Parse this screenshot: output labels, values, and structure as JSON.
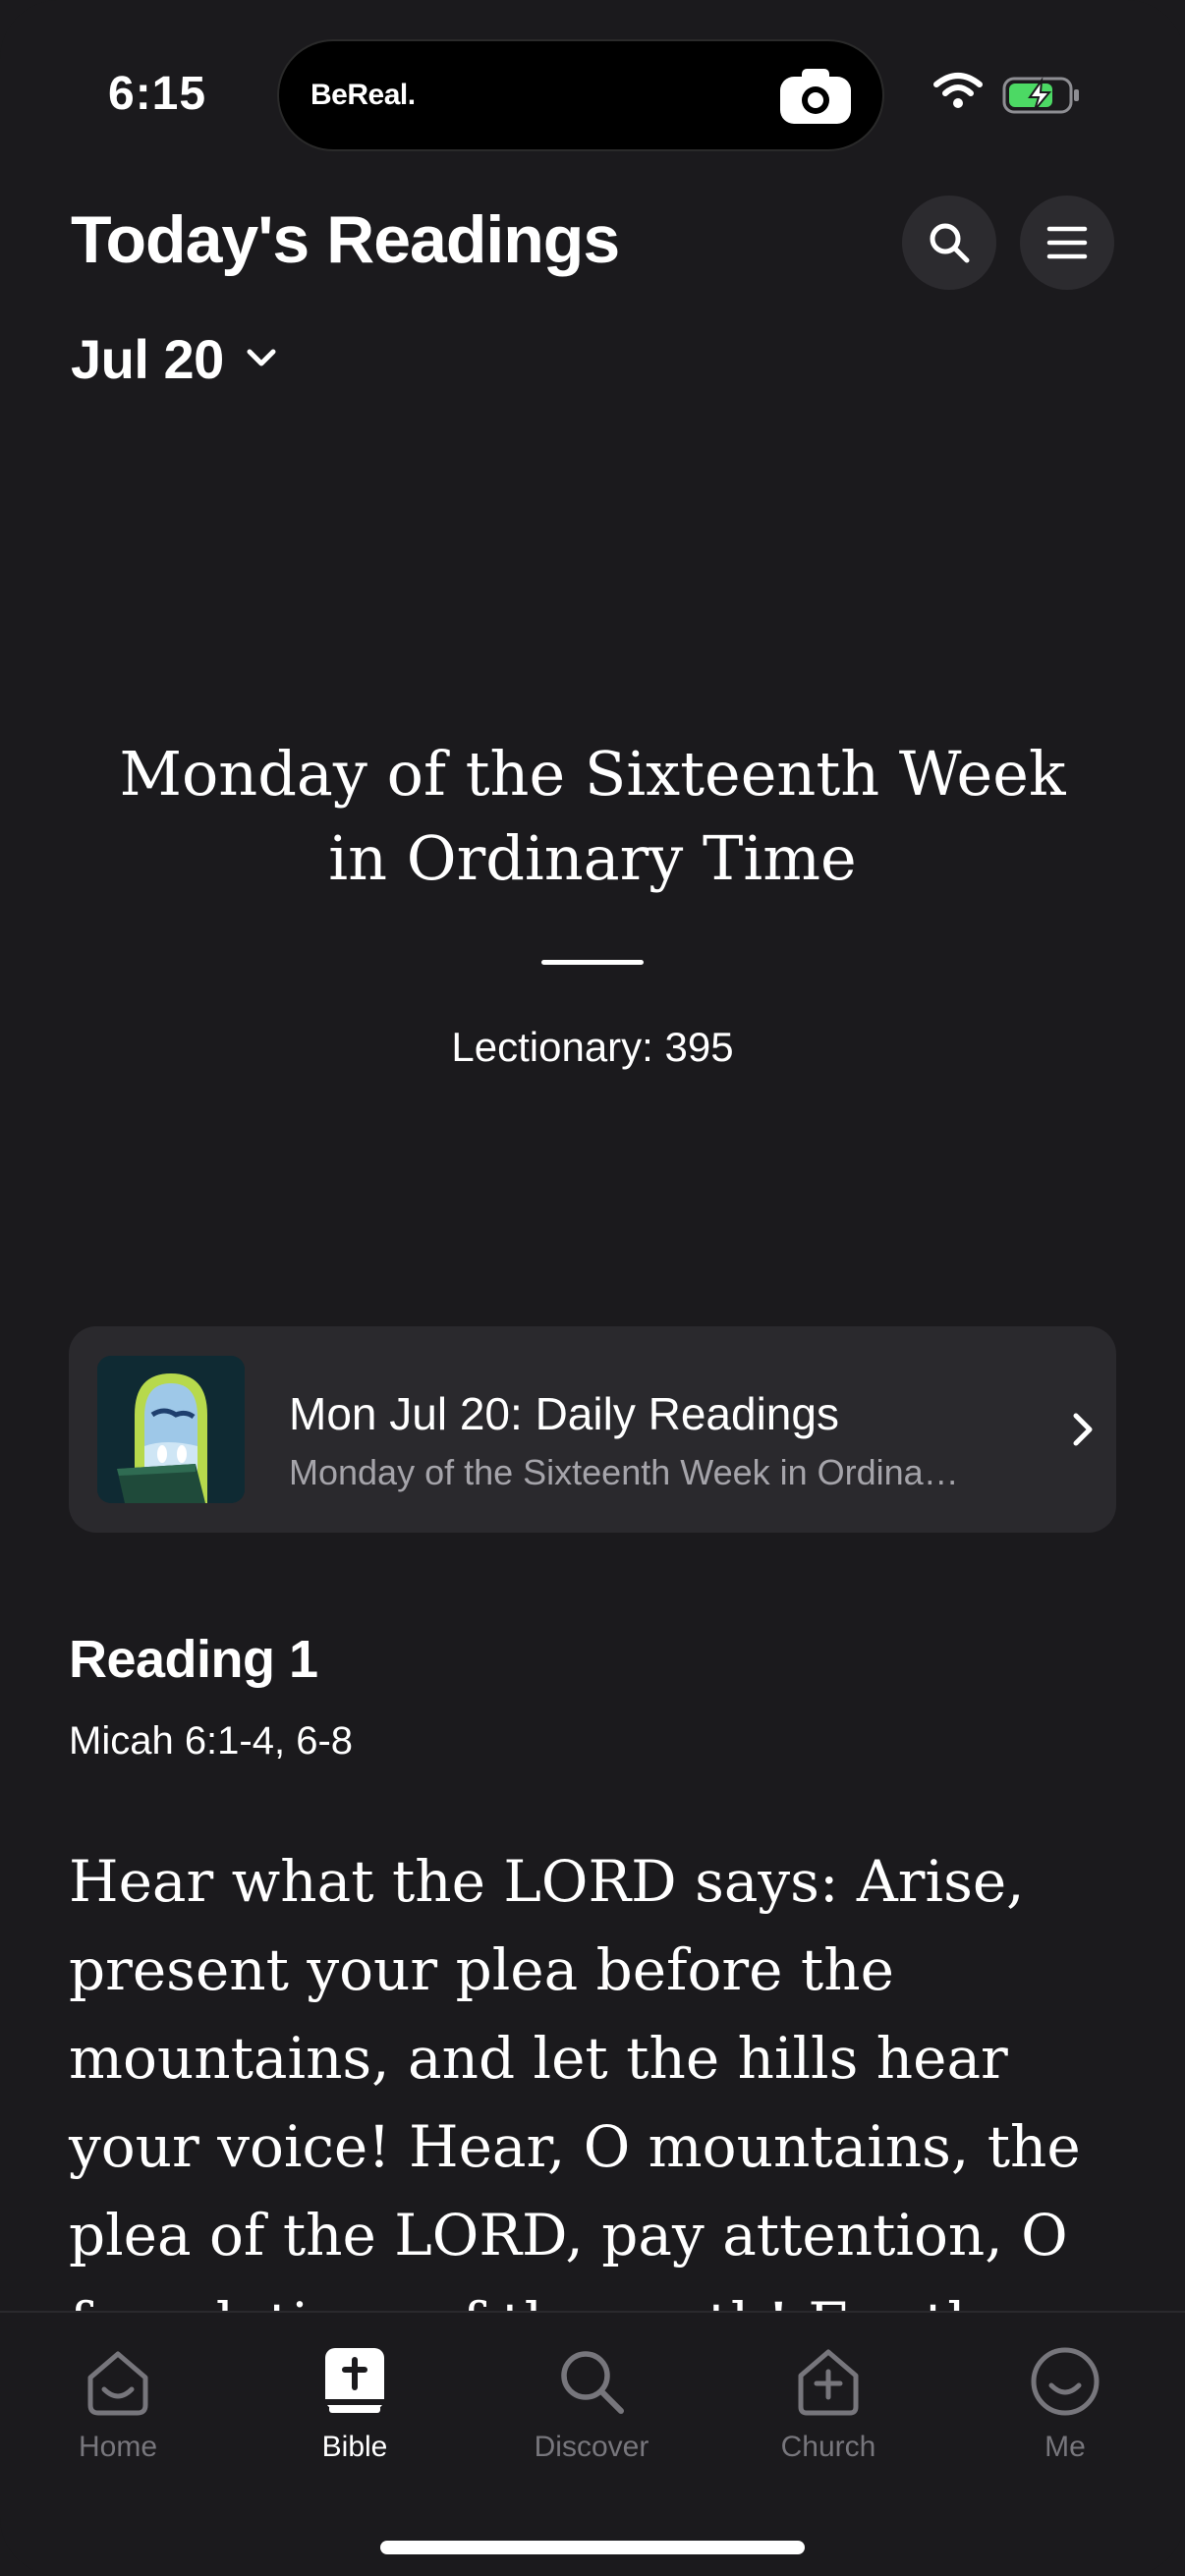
{
  "status_bar": {
    "time": "6:15",
    "island_label": "BeReal.",
    "icons": [
      "camera-icon",
      "wifi-icon",
      "battery-charging-icon"
    ]
  },
  "header": {
    "title": "Today's Readings",
    "date": "Jul 20",
    "icons": [
      "search-icon",
      "menu-icon",
      "chevron-down-icon"
    ]
  },
  "liturgy": {
    "day_name": "Monday of the Sixteenth Week in Ordinary Time",
    "lectionary": "Lectionary: 395"
  },
  "card": {
    "title": "Mon Jul 20: Daily Readings",
    "subtitle": "Monday of the Sixteenth Week in Ordinary Time",
    "icon": "chevron-right-icon"
  },
  "reading": {
    "heading": "Reading 1",
    "citation": "Micah 6:1-4, 6-8",
    "text": "Hear what the LORD says: Arise, present your plea before the mountains, and let the hills hear your voice! Hear, O mountains, the plea of the LORD, pay attention, O foundations of the earth! For the"
  },
  "tabs": [
    {
      "label": "Home",
      "icon": "home-icon"
    },
    {
      "label": "Bible",
      "icon": "bible-icon",
      "active": true
    },
    {
      "label": "Discover",
      "icon": "search-icon"
    },
    {
      "label": "Church",
      "icon": "church-icon"
    },
    {
      "label": "Me",
      "icon": "profile-icon"
    }
  ],
  "colors": {
    "background": "#1b1a1d",
    "card": "#2a292d",
    "muted_text": "#a5a4aa",
    "inactive_tab": "#77767c",
    "battery_charge": "#4cd964"
  }
}
